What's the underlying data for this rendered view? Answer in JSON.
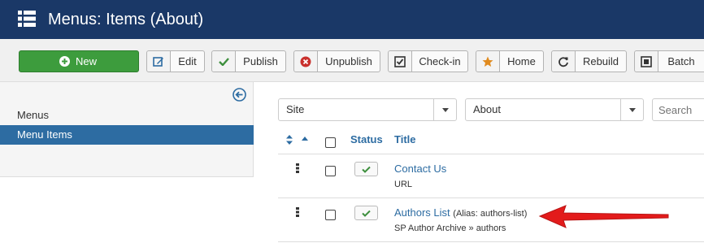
{
  "header": {
    "title": "Menus: Items (About)",
    "icon": "list-icon"
  },
  "toolbar": {
    "new_label": "New",
    "edit_label": "Edit",
    "publish_label": "Publish",
    "unpublish_label": "Unpublish",
    "checkin_label": "Check-in",
    "home_label": "Home",
    "rebuild_label": "Rebuild",
    "batch_label": "Batch"
  },
  "sidebar": {
    "items": [
      {
        "label": "Menus"
      },
      {
        "label": "Menu Items"
      }
    ]
  },
  "filters": {
    "client": "Site",
    "menu": "About",
    "search_placeholder": "Search"
  },
  "table": {
    "headers": {
      "status": "Status",
      "title": "Title"
    },
    "rows": [
      {
        "title": "Contact Us",
        "alias": "",
        "type": "URL"
      },
      {
        "title": "Authors List",
        "alias": "(Alias: authors-list)",
        "type": "SP Author Archive » authors"
      }
    ]
  },
  "colors": {
    "header_bg": "#1a3867",
    "new_button": "#3d9c3d",
    "link": "#2d6ca2",
    "annotation_arrow": "#e31b1b"
  }
}
